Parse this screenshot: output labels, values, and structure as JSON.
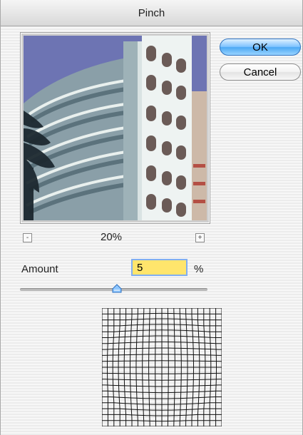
{
  "window": {
    "title": "Pinch"
  },
  "buttons": {
    "ok": "OK",
    "cancel": "Cancel"
  },
  "zoom": {
    "minus": "-",
    "plus": "+",
    "level": "20%"
  },
  "amount": {
    "label": "Amount",
    "value": "5",
    "unit": "%",
    "slider_fraction": 0.53
  },
  "colors": {
    "accent": "#4da9f4",
    "field_bg": "#ffe56c",
    "grid": "#111111"
  }
}
